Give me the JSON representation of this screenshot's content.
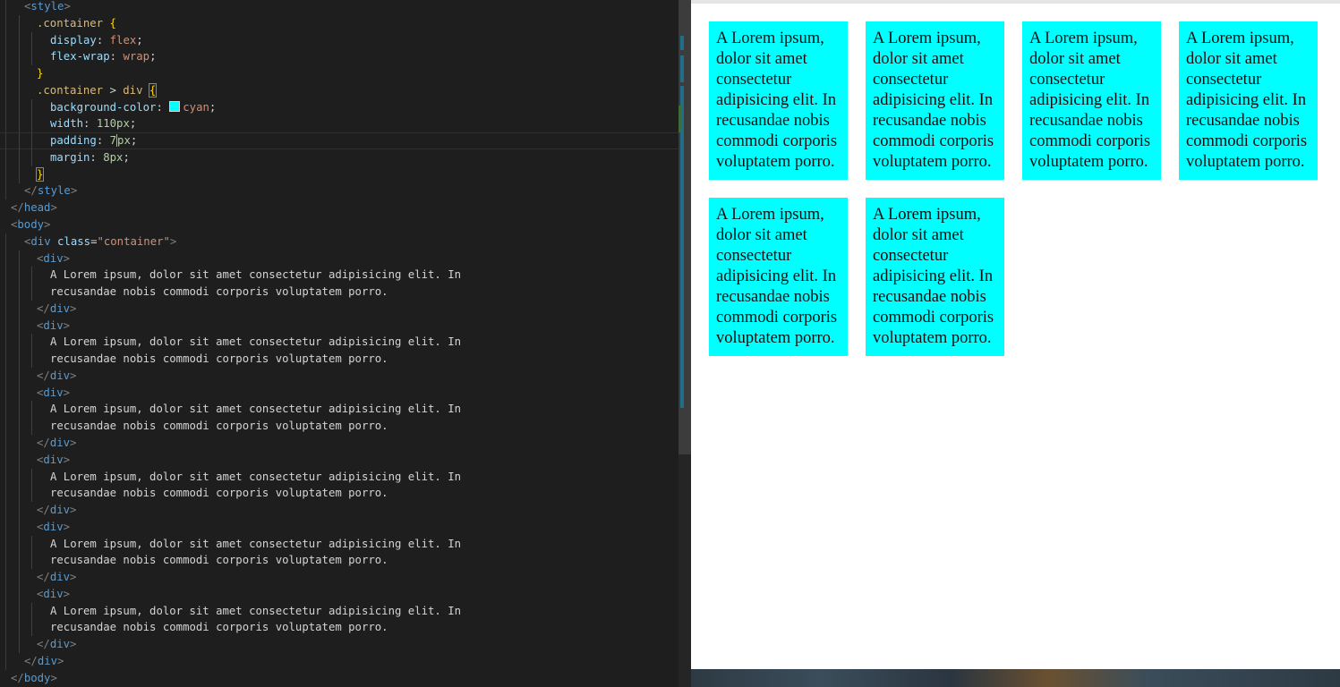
{
  "editor": {
    "lines": [
      {
        "guides": 1,
        "indent": 27,
        "html": "<span class=\"t-br\">&lt;</span><span class=\"t-tag\">style</span><span class=\"t-br\">&gt;</span>"
      },
      {
        "guides": 2,
        "indent": 41,
        "html": "<span class=\"t-sel\">.container</span> <span class=\"t-brace\">{</span>"
      },
      {
        "guides": 3,
        "indent": 56,
        "html": "<span class=\"t-prop\">display</span><span class=\"t-punc\">: </span><span class=\"t-val\">flex</span><span class=\"t-punc\">;</span>"
      },
      {
        "guides": 3,
        "indent": 56,
        "html": "<span class=\"t-prop\">flex-wrap</span><span class=\"t-punc\">: </span><span class=\"t-val\">wrap</span><span class=\"t-punc\">;</span>"
      },
      {
        "guides": 2,
        "indent": 41,
        "html": "<span class=\"t-brace\">}</span>"
      },
      {
        "guides": 2,
        "indent": 41,
        "html": "<span class=\"t-sel\">.container</span> <span class=\"t-punc\">&gt;</span> <span class=\"t-sel\">div</span> <span class=\"t-brace brace-box\">{</span>"
      },
      {
        "guides": 3,
        "indent": 56,
        "html": "<span class=\"t-prop\">background-color</span><span class=\"t-punc\">: </span><span class=\"swatch\"></span><span class=\"t-val\">cyan</span><span class=\"t-punc\">;</span>"
      },
      {
        "guides": 3,
        "indent": 56,
        "html": "<span class=\"t-prop\">width</span><span class=\"t-punc\">: </span><span class=\"t-num\">110px</span><span class=\"t-punc\">;</span>"
      },
      {
        "guides": 3,
        "indent": 56,
        "current": true,
        "html": "<span class=\"t-prop\">padding</span><span class=\"t-punc\">: </span><span class=\"t-num\">7<span class=\"cursor\"></span>px</span><span class=\"t-punc\">;</span>"
      },
      {
        "guides": 3,
        "indent": 56,
        "html": "<span class=\"t-prop\">margin</span><span class=\"t-punc\">: </span><span class=\"t-num\">8px</span><span class=\"t-punc\">;</span>"
      },
      {
        "guides": 2,
        "indent": 41,
        "html": "<span class=\"t-brace brace-box\">}</span>"
      },
      {
        "guides": 1,
        "indent": 27,
        "html": "<span class=\"t-br\">&lt;/</span><span class=\"t-tag\">style</span><span class=\"t-br\">&gt;</span>"
      },
      {
        "guides": 0,
        "indent": 12,
        "html": "<span class=\"t-br\">&lt;/</span><span class=\"t-tag\">head</span><span class=\"t-br\">&gt;</span>"
      },
      {
        "guides": 0,
        "indent": 12,
        "html": "<span class=\"t-br\">&lt;</span><span class=\"t-tag\">body</span><span class=\"t-br\">&gt;</span>"
      },
      {
        "guides": 1,
        "indent": 27,
        "html": "<span class=\"t-br\">&lt;</span><span class=\"t-tag\">div</span> <span class=\"t-attr\">class</span><span class=\"t-punc\">=</span><span class=\"t-str\">\"container\"</span><span class=\"t-br\">&gt;</span>"
      },
      {
        "guides": 2,
        "indent": 41,
        "html": "<span class=\"t-br\">&lt;</span><span class=\"t-tag\">div</span><span class=\"t-br\">&gt;</span>"
      },
      {
        "guides": 3,
        "indent": 56,
        "html": "<span class=\"t-text\">A Lorem ipsum, dolor sit amet consectetur adipisicing elit. In</span>"
      },
      {
        "guides": 3,
        "indent": 56,
        "html": "<span class=\"t-text\">recusandae nobis commodi corporis voluptatem porro.</span>"
      },
      {
        "guides": 2,
        "indent": 41,
        "html": "<span class=\"t-br\">&lt;/</span><span class=\"t-tag\">div</span><span class=\"t-br\">&gt;</span>"
      },
      {
        "guides": 2,
        "indent": 41,
        "html": "<span class=\"t-br\">&lt;</span><span class=\"t-tag\">div</span><span class=\"t-br\">&gt;</span>"
      },
      {
        "guides": 3,
        "indent": 56,
        "html": "<span class=\"t-text\">A Lorem ipsum, dolor sit amet consectetur adipisicing elit. In</span>"
      },
      {
        "guides": 3,
        "indent": 56,
        "html": "<span class=\"t-text\">recusandae nobis commodi corporis voluptatem porro.</span>"
      },
      {
        "guides": 2,
        "indent": 41,
        "html": "<span class=\"t-br\">&lt;/</span><span class=\"t-tag\">div</span><span class=\"t-br\">&gt;</span>"
      },
      {
        "guides": 2,
        "indent": 41,
        "html": "<span class=\"t-br\">&lt;</span><span class=\"t-tag\">div</span><span class=\"t-br\">&gt;</span>"
      },
      {
        "guides": 3,
        "indent": 56,
        "html": "<span class=\"t-text\">A Lorem ipsum, dolor sit amet consectetur adipisicing elit. In</span>"
      },
      {
        "guides": 3,
        "indent": 56,
        "html": "<span class=\"t-text\">recusandae nobis commodi corporis voluptatem porro.</span>"
      },
      {
        "guides": 2,
        "indent": 41,
        "html": "<span class=\"t-br\">&lt;/</span><span class=\"t-tag\">div</span><span class=\"t-br\">&gt;</span>"
      },
      {
        "guides": 2,
        "indent": 41,
        "html": "<span class=\"t-br\">&lt;</span><span class=\"t-tag\">div</span><span class=\"t-br\">&gt;</span>"
      },
      {
        "guides": 3,
        "indent": 56,
        "html": "<span class=\"t-text\">A Lorem ipsum, dolor sit amet consectetur adipisicing elit. In</span>"
      },
      {
        "guides": 3,
        "indent": 56,
        "html": "<span class=\"t-text\">recusandae nobis commodi corporis voluptatem porro.</span>"
      },
      {
        "guides": 2,
        "indent": 41,
        "html": "<span class=\"t-br\">&lt;/</span><span class=\"t-tag\">div</span><span class=\"t-br\">&gt;</span>"
      },
      {
        "guides": 2,
        "indent": 41,
        "html": "<span class=\"t-br\">&lt;</span><span class=\"t-tag\">div</span><span class=\"t-br\">&gt;</span>"
      },
      {
        "guides": 3,
        "indent": 56,
        "html": "<span class=\"t-text\">A Lorem ipsum, dolor sit amet consectetur adipisicing elit. In</span>"
      },
      {
        "guides": 3,
        "indent": 56,
        "html": "<span class=\"t-text\">recusandae nobis commodi corporis voluptatem porro.</span>"
      },
      {
        "guides": 2,
        "indent": 41,
        "html": "<span class=\"t-br\">&lt;/</span><span class=\"t-tag\">div</span><span class=\"t-br\">&gt;</span>"
      },
      {
        "guides": 2,
        "indent": 41,
        "html": "<span class=\"t-br\">&lt;</span><span class=\"t-tag\">div</span><span class=\"t-br\">&gt;</span>"
      },
      {
        "guides": 3,
        "indent": 56,
        "html": "<span class=\"t-text\">A Lorem ipsum, dolor sit amet consectetur adipisicing elit. In</span>"
      },
      {
        "guides": 3,
        "indent": 56,
        "html": "<span class=\"t-text\">recusandae nobis commodi corporis voluptatem porro.</span>"
      },
      {
        "guides": 2,
        "indent": 41,
        "html": "<span class=\"t-br\">&lt;/</span><span class=\"t-tag\">div</span><span class=\"t-br\">&gt;</span>"
      },
      {
        "guides": 1,
        "indent": 27,
        "html": "<span class=\"t-br\">&lt;/</span><span class=\"t-tag\">div</span><span class=\"t-br\">&gt;</span>"
      },
      {
        "guides": 0,
        "indent": 12,
        "html": "<span class=\"t-br\">&lt;/</span><span class=\"t-tag\">body</span><span class=\"t-br\">&gt;</span>"
      }
    ]
  },
  "preview": {
    "boxes": [
      "A Lorem ipsum, dolor sit amet consectetur adipisicing elit. In recusandae nobis commodi corporis voluptatem porro.",
      "A Lorem ipsum, dolor sit amet consectetur adipisicing elit. In recusandae nobis commodi corporis voluptatem porro.",
      "A Lorem ipsum, dolor sit amet consectetur adipisicing elit. In recusandae nobis commodi corporis voluptatem porro.",
      "A Lorem ipsum, dolor sit amet consectetur adipisicing elit. In recusandae nobis commodi corporis voluptatem porro.",
      "A Lorem ipsum, dolor sit amet consectetur adipisicing elit. In recusandae nobis commodi corporis voluptatem porro.",
      "A Lorem ipsum, dolor sit amet consectetur adipisicing elit. In recusandae nobis commodi corporis voluptatem porro."
    ],
    "box_color": "#00ffff"
  }
}
